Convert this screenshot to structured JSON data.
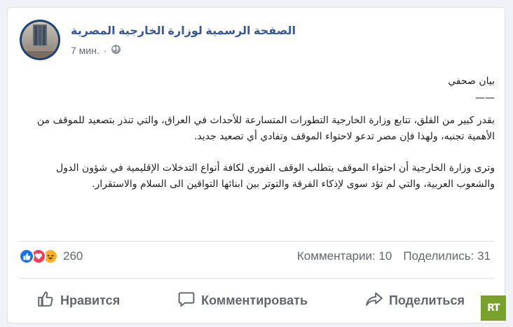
{
  "post": {
    "page_name": "الصفحة الرسمية لوزارة الخارجية المصرية",
    "time": "7 мин.",
    "separator_dot": "·",
    "audience_icon": "globe-icon",
    "title_line": "بيان صحفي",
    "dash_line": "——",
    "paragraph1": "بقدر كبير من القلق، تتابع وزارة الخارجية التطورات المتسارعة للأحداث في العراق، والتي تنذر بتصعيد للموقف من الأهمية تجنبه، ولهذا فإن مصر تدعو لاحتواء الموقف وتفادي أي تصعيد جديد.",
    "paragraph2": "وترى وزارة الخارجية أن احتواء الموقف يتطلب الوقف الفوري لكافة أنواع التدخلات الإقليمية في شؤون الدول والشعوب العربية، والتي لم تؤد سوى لإذكاء الفرقة والتوتر بين ابنائها التواقين الى السلام والاستقرار."
  },
  "reactions": {
    "icons": [
      "like-icon",
      "love-icon",
      "haha-icon"
    ],
    "count": "260",
    "comments": "Комментарии: 10",
    "shares": "Поделились: 31"
  },
  "actions": {
    "like": "Нравится",
    "comment": "Комментировать",
    "share": "Поделиться"
  },
  "watermark": "RT",
  "colors": {
    "page_name": "#365899",
    "secondary_text": "#606770",
    "like_blue": "#1b74e4",
    "love_red": "#f33e58",
    "haha_yellow": "#f7b125",
    "rt_green": "#78a02b"
  }
}
